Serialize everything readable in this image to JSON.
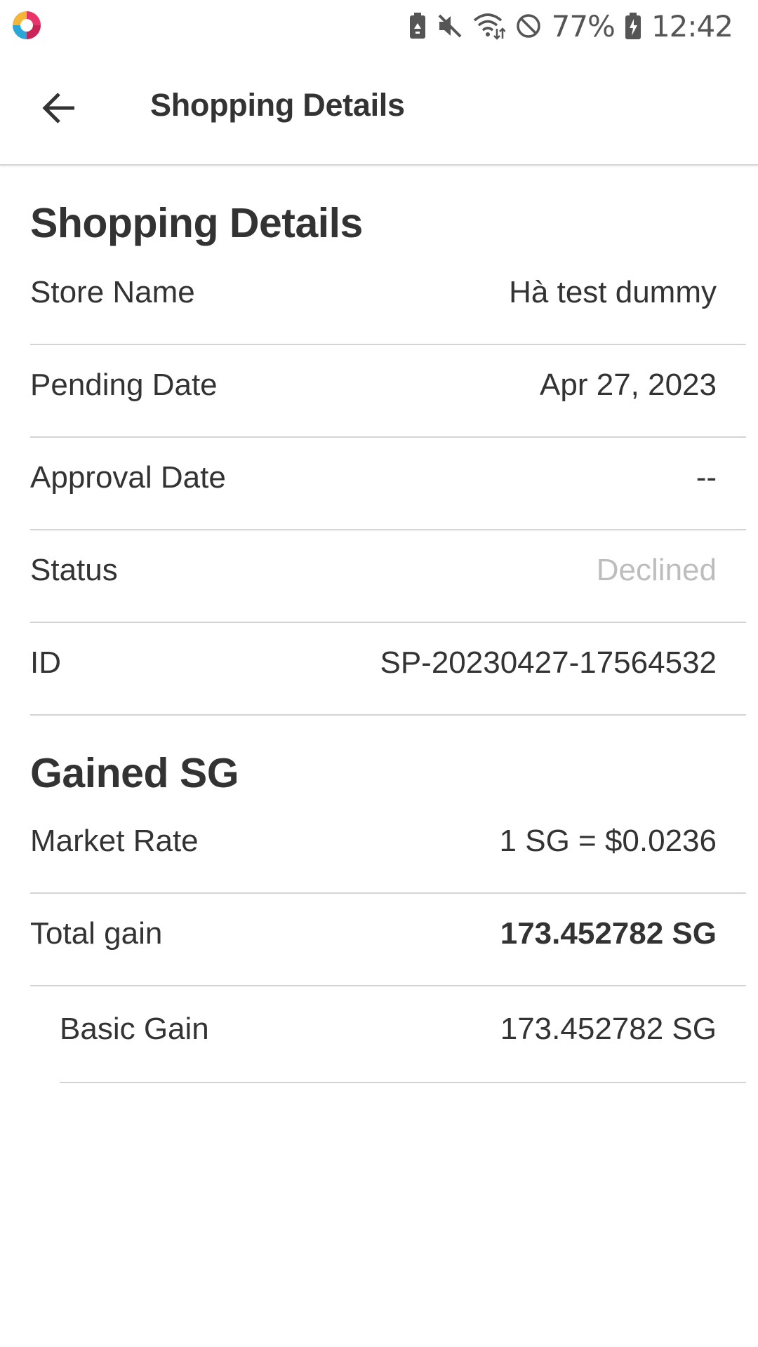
{
  "status_bar": {
    "battery_percent": "77%",
    "time": "12:42",
    "icons": [
      "app-icon",
      "battery-saver-icon",
      "mute-icon",
      "wifi-icon",
      "do-not-disturb-icon",
      "battery-icon"
    ]
  },
  "app_bar": {
    "title": "Shopping Details",
    "back_icon": "arrow-left-icon"
  },
  "shopping_details": {
    "title": "Shopping Details",
    "rows": [
      {
        "label": "Store Name",
        "value": "Hà test dummy"
      },
      {
        "label": "Pending Date",
        "value": "Apr 27, 2023"
      },
      {
        "label": "Approval Date",
        "value": "--"
      },
      {
        "label": "Status",
        "value": "Declined"
      },
      {
        "label": "ID",
        "value": "SP-20230427-17564532"
      }
    ]
  },
  "gained_sg": {
    "title": "Gained SG",
    "rows": [
      {
        "label": "Market Rate",
        "value": "1 SG = $0.0236"
      },
      {
        "label": "Total gain",
        "value": "173.452782 SG"
      },
      {
        "label": "Basic Gain",
        "value": "173.452782 SG"
      }
    ]
  },
  "colors": {
    "text": "#333333",
    "status_declined": "#bdbdbd",
    "divider": "#d4d4d4",
    "background": "#ffffff"
  }
}
